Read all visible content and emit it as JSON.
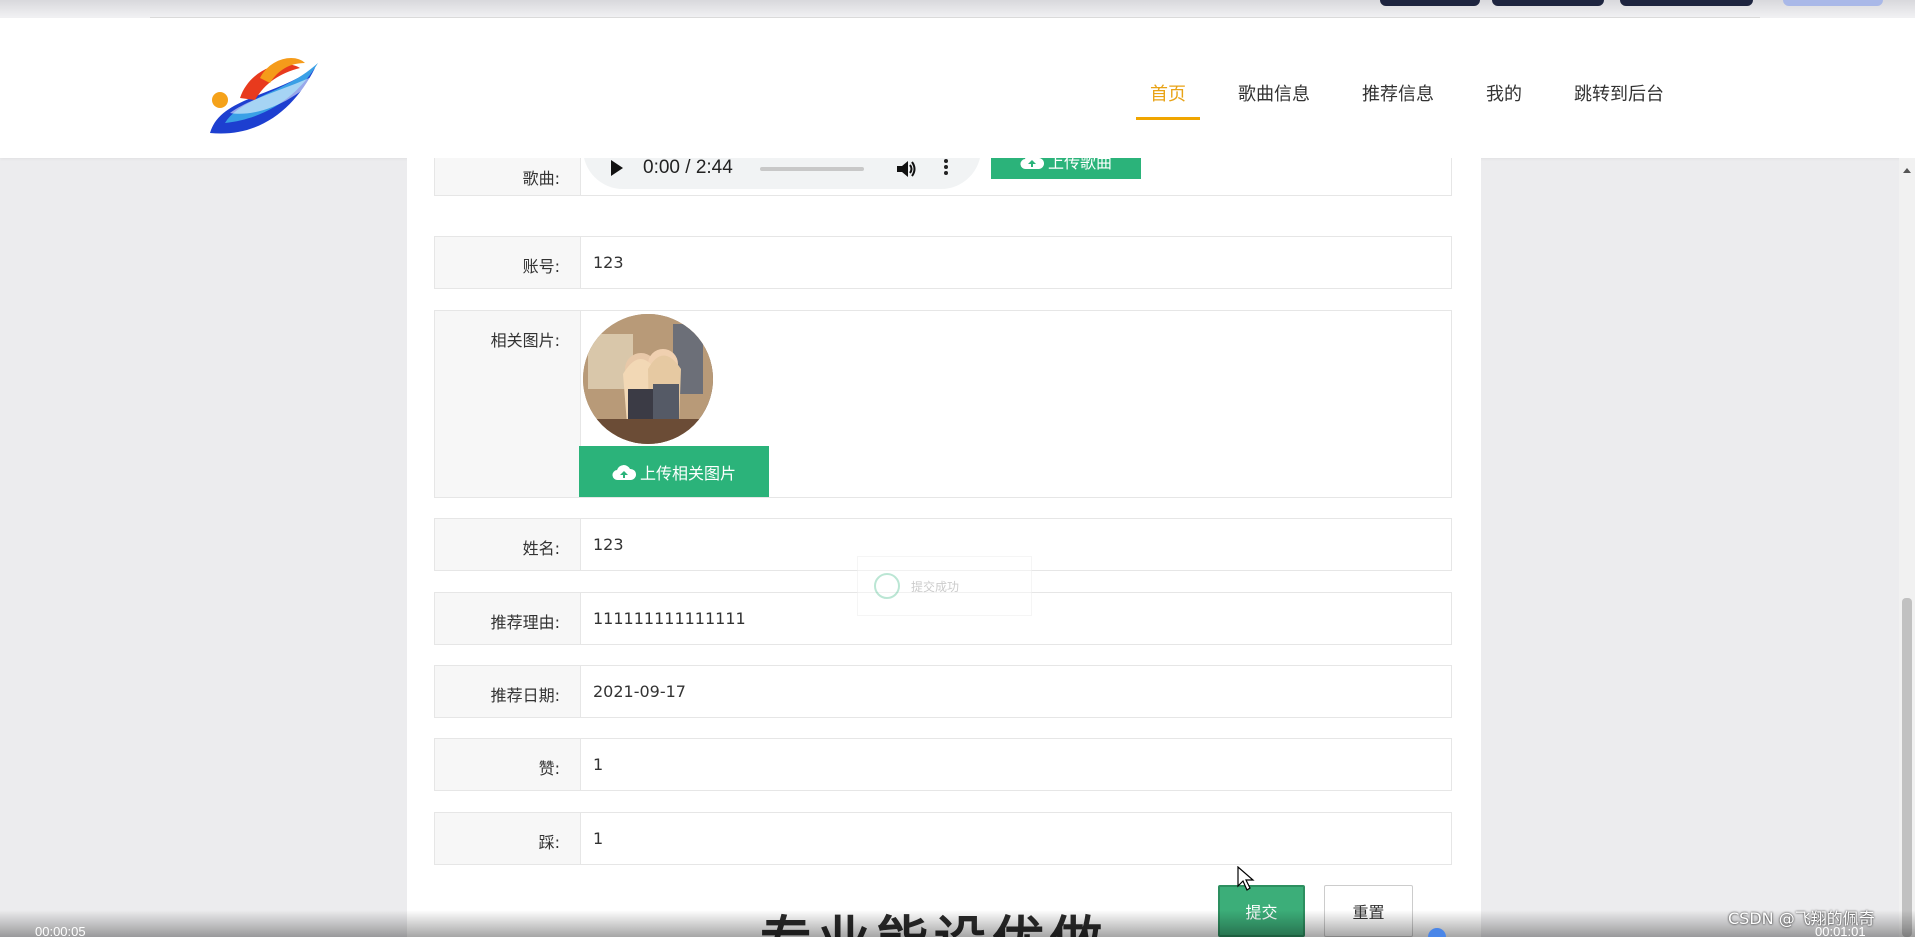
{
  "nav": {
    "items": [
      {
        "label": "首页",
        "active": true
      },
      {
        "label": "歌曲信息",
        "active": false
      },
      {
        "label": "推荐信息",
        "active": false
      },
      {
        "label": "我的",
        "active": false
      },
      {
        "label": "跳转到后台",
        "active": false
      }
    ]
  },
  "form": {
    "song": {
      "label": "歌曲:",
      "audio_time": "0:00 / 2:44",
      "upload_label": "上传歌曲"
    },
    "account": {
      "label": "账号:",
      "value": "123"
    },
    "image": {
      "label": "相关图片:",
      "upload_label": "上传相关图片"
    },
    "name": {
      "label": "姓名:",
      "value": "123"
    },
    "reason": {
      "label": "推荐理由:",
      "value": "111111111111111"
    },
    "date": {
      "label": "推荐日期:",
      "value": "2021-09-17"
    },
    "like": {
      "label": "赞:",
      "value": "1"
    },
    "dislike": {
      "label": "踩:",
      "value": "1"
    },
    "submit_label": "提交",
    "reset_label": "重置"
  },
  "toast": {
    "message": "提交成功"
  },
  "banner_text": "专业能设优做",
  "video": {
    "left_time": "00:00:05",
    "right_time": "00:01:01"
  },
  "watermark": "CSDN @飞翔的佩奇",
  "colors": {
    "accent": "#f0a500",
    "primary_button": "#2bb37a",
    "submit_button": "#3cae79"
  }
}
